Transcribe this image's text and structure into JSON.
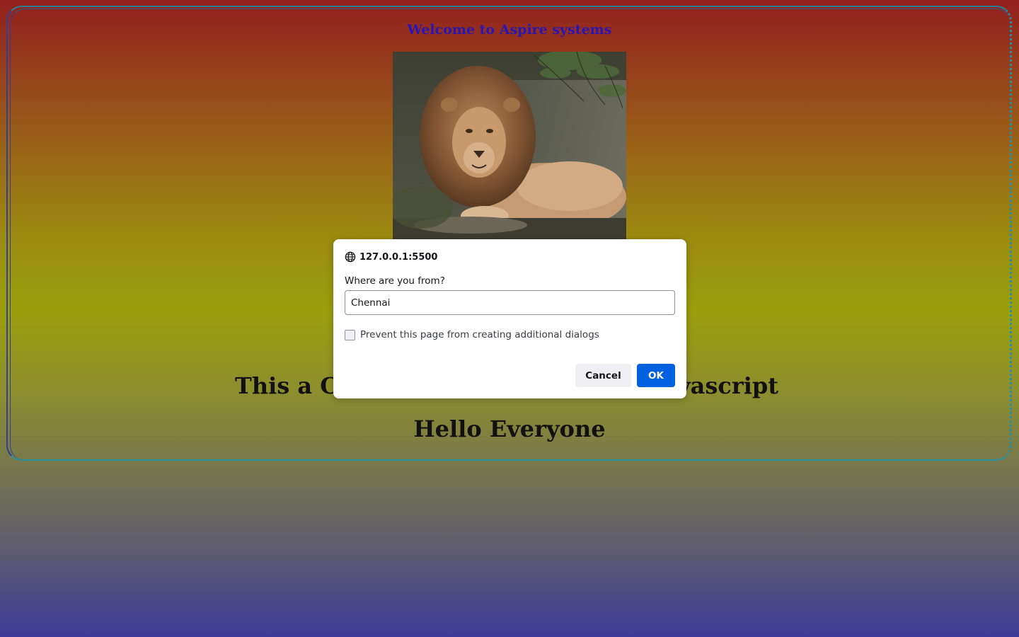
{
  "page": {
    "welcome_text": "Welcome to Aspire systems",
    "image_alt": "lion",
    "headline_left": "This a C",
    "headline_right": "vascript",
    "hello_text": "Hello Everyone"
  },
  "dialog": {
    "origin": "127.0.0.1:5500",
    "origin_icon": "globe-icon",
    "message": "Where are you from?",
    "input_value": "Chennai",
    "checkbox_label": "Prevent this page from creating additional dialogs",
    "checkbox_checked": false,
    "cancel_label": "Cancel",
    "ok_label": "OK"
  },
  "colors": {
    "welcome": "#2a16b2",
    "ok_button": "#0061e0",
    "cancel_button": "#f0f0f4"
  }
}
